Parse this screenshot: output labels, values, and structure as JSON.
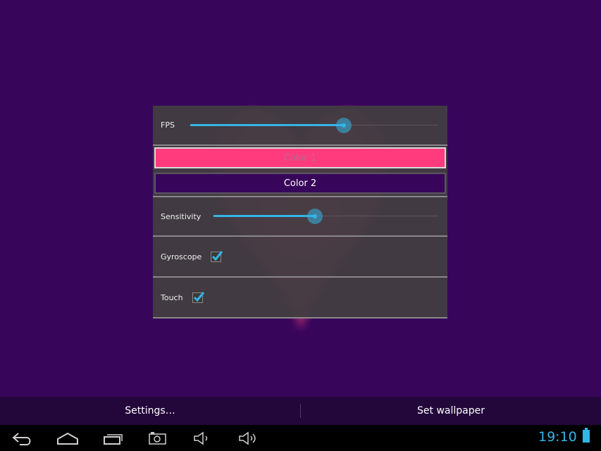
{
  "colors": {
    "background": "#37065a",
    "accent": "#33b5e5",
    "color1": "#ff3b7e",
    "color2": "#37065a"
  },
  "settings": {
    "fps": {
      "label": "FPS",
      "value": 0.62
    },
    "color1_label": "Color 1",
    "color2_label": "Color 2",
    "sensitivity": {
      "label": "Sensitivity",
      "value": 0.45
    },
    "gyroscope": {
      "label": "Gyroscope",
      "checked": true
    },
    "touch": {
      "label": "Touch",
      "checked": true
    }
  },
  "action_bar": {
    "settings_label": "Settings…",
    "set_wallpaper_label": "Set wallpaper"
  },
  "nav_bar": {
    "icons": [
      "back-icon",
      "home-icon",
      "recent-apps-icon",
      "screenshot-icon",
      "volume-down-icon",
      "volume-up-icon"
    ]
  },
  "status": {
    "time": "19:10",
    "battery_icon": "battery-icon"
  }
}
